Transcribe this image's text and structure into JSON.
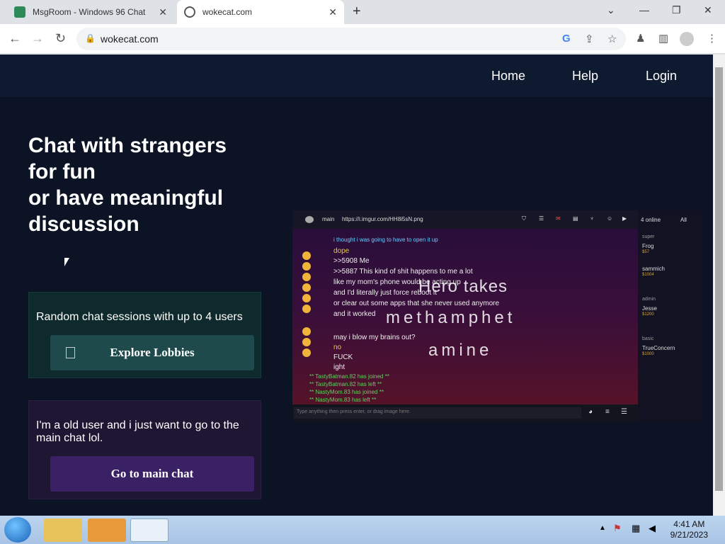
{
  "browser": {
    "tabs": [
      {
        "title": "MsgRoom - Windows 96 Chat",
        "close": "✕"
      },
      {
        "title": "wokecat.com",
        "close": "✕"
      }
    ],
    "new_tab": "+",
    "window_controls": {
      "dropdown": "⌄",
      "minimize": "—",
      "restore": "❐",
      "close": "✕"
    },
    "nav": {
      "back": "←",
      "forward": "→",
      "reload": "↻"
    },
    "url": "wokecat.com",
    "lock": "🔒"
  },
  "site": {
    "nav": [
      "Home",
      "Help",
      "Login"
    ],
    "hero": [
      "Chat with strangers",
      "for fun",
      "or have meaningful",
      "discussion"
    ],
    "card_random": {
      "desc": "Random chat sessions with up to 4 users",
      "button": "Explore Lobbies"
    },
    "card_main": {
      "desc": "I'm a old user and i just want to go to the main chat lol.",
      "button": "Go to main chat"
    }
  },
  "screenshot": {
    "room": "main",
    "topic": "https://i.imgur.com/HH8i5sN.png",
    "online": "4 online",
    "filter": "All",
    "users": [
      {
        "role": "super",
        "name": "Frog",
        "amount": "$57"
      },
      {
        "role": "",
        "name": "sammich",
        "amount": "$1004"
      },
      {
        "role": "admin",
        "name": "Jesse",
        "amount": "$1200"
      },
      {
        "role": "basic",
        "name": "TrueConcern",
        "amount": "$1000"
      }
    ],
    "messages": [
      "i thought i was going to have to open it up",
      "dope",
      ">>5908 Me",
      ">>5887 This kind of shit happens to me a lot",
      "like my mom's phone would be acting up",
      "and I'd literally just force reboot it",
      "or clear out some apps that she never used anymore",
      "and it worked",
      "may i blow my brains out?",
      "no",
      "FUCK",
      "ight"
    ],
    "joins": [
      "** TastyBatman.82 has joined **",
      "** TastyBatman.82 has left **",
      "** NastyMom.83 has joined **",
      "** NastyMom.83 has left **"
    ],
    "overlay": [
      "Hero takes",
      "methamphet",
      "amine"
    ],
    "input_placeholder": "Type anything then press enter, or drag image here."
  },
  "taskbar": {
    "time": "4:41 AM",
    "date": "9/21/2023"
  }
}
